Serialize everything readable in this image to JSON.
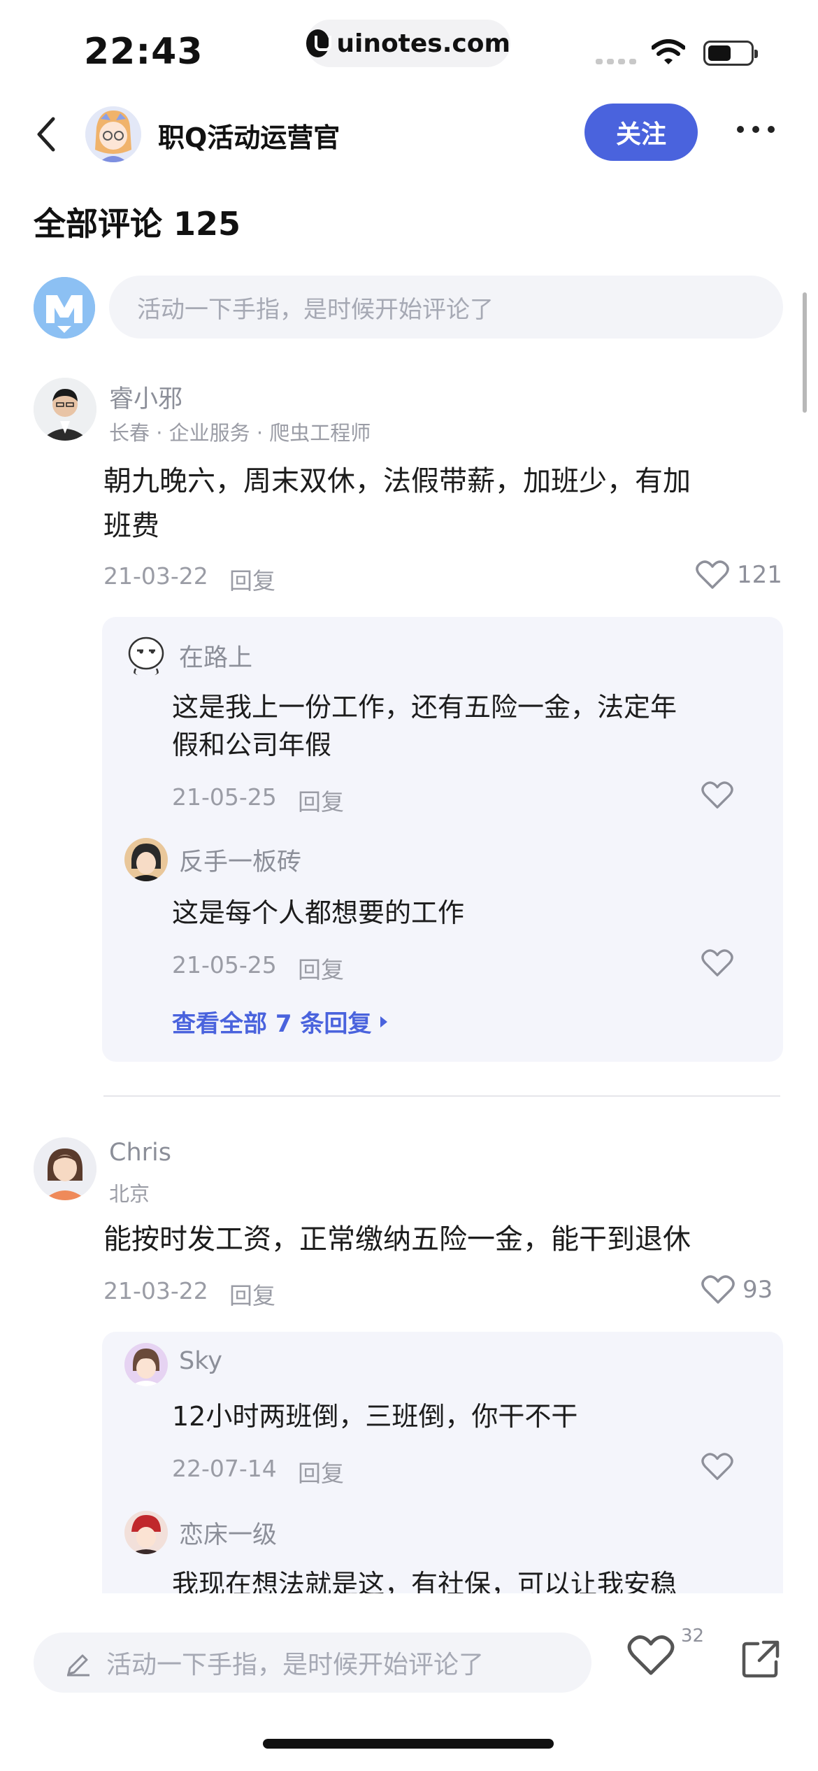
{
  "status_bar": {
    "time": "22:43",
    "url": "uinotes.com"
  },
  "nav": {
    "title": "职Q活动运营官",
    "follow_label": "关注"
  },
  "comments_section": {
    "title": "全部评论 125",
    "input_placeholder": "活动一下手指，是时候开始评论了"
  },
  "comments": [
    {
      "user": "睿小邪",
      "meta": "长春 · 企业服务 · 爬虫工程师",
      "text_line1": "朝九晚六，周末双休，法假带薪，加班少，有加",
      "text_line2": "班费",
      "date": "21-03-22",
      "reply_label": "回复",
      "likes": "121",
      "replies": [
        {
          "user": "在路上",
          "text_line1": "这是我上一份工作，还有五险一金，法定年",
          "text_line2": "假和公司年假",
          "date": "21-05-25",
          "reply_label": "回复"
        },
        {
          "user": "反手一板砖",
          "text": "这是每个人都想要的工作",
          "date": "21-05-25",
          "reply_label": "回复"
        }
      ],
      "view_all": "查看全部 7 条回复"
    },
    {
      "user": "Chris",
      "meta": "北京",
      "text": "能按时发工资，正常缴纳五险一金，能干到退休",
      "date": "21-03-22",
      "reply_label": "回复",
      "likes": "93",
      "replies": [
        {
          "user": "Sky",
          "text": "12小时两班倒，三班倒，你干不干",
          "date": "22-07-14",
          "reply_label": "回复"
        },
        {
          "user": "恋床一级",
          "text": "我现在想法就是这，有社保，可以让我安稳"
        }
      ]
    }
  ],
  "bottom_bar": {
    "input_placeholder": "活动一下手指，是时候开始评论了",
    "like_count": "32"
  },
  "colors": {
    "accent": "#4a63dd",
    "reply_bg": "#f4f5fb",
    "muted_text": "#9a9ca5"
  }
}
